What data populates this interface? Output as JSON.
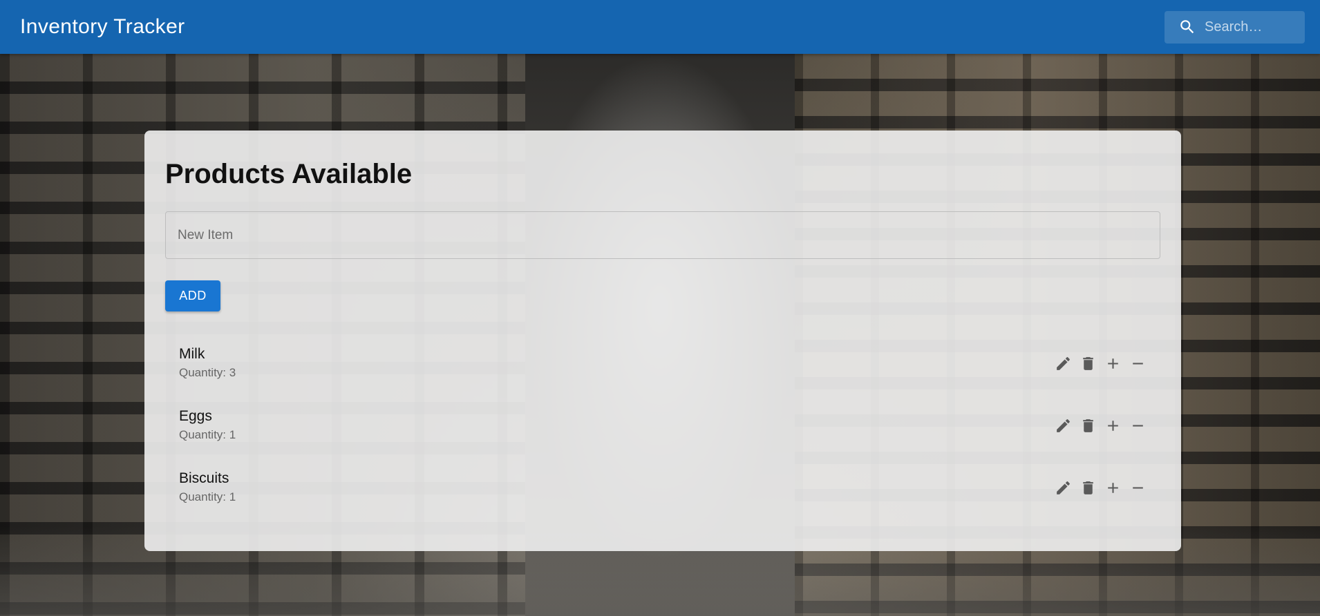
{
  "appbar": {
    "title": "Inventory Tracker",
    "search_placeholder": "Search…"
  },
  "main": {
    "title": "Products Available",
    "new_item_placeholder": "New Item",
    "add_label": "ADD",
    "items": [
      {
        "name": "Milk",
        "quantity": "Quantity: 3"
      },
      {
        "name": "Eggs",
        "quantity": "Quantity: 1"
      },
      {
        "name": "Biscuits",
        "quantity": "Quantity: 1"
      }
    ]
  },
  "icons": {
    "search": "search-icon",
    "edit": "edit-icon",
    "delete": "delete-icon",
    "increment": "plus-icon",
    "decrement": "minus-icon"
  },
  "colors": {
    "appbar": "#1565b0",
    "primary_button": "#1976d2",
    "card_background": "#f0f0f0",
    "icon": "#5a5a5a"
  }
}
